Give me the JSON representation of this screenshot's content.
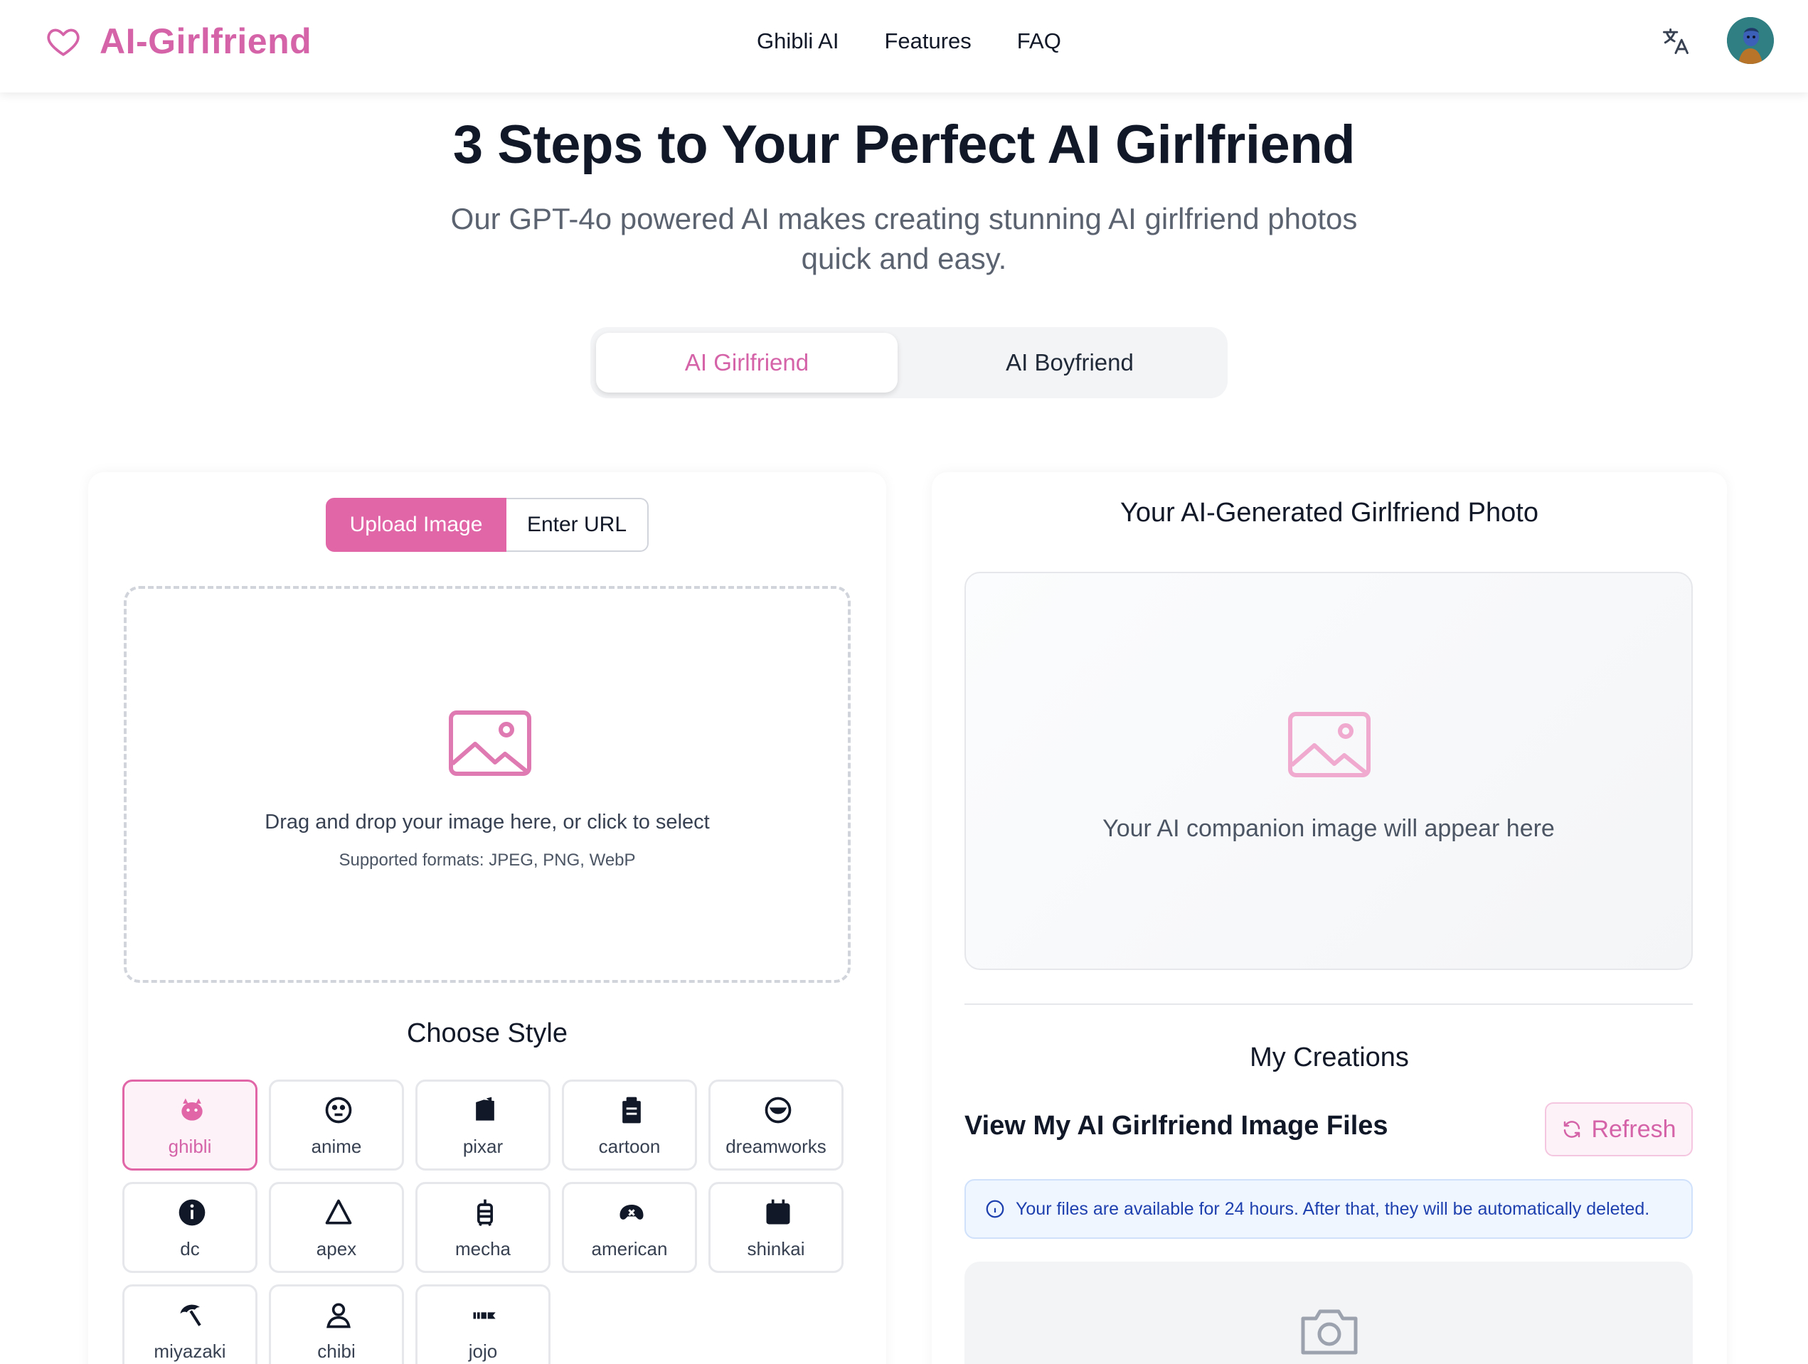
{
  "brand": {
    "name": "AI-Girlfriend",
    "color": "#d463a8"
  },
  "nav": {
    "items": [
      "Ghibli AI",
      "Features",
      "FAQ"
    ]
  },
  "header": {
    "language_icon": "translate-icon",
    "avatar_icon": "user-avatar"
  },
  "hero": {
    "title": "3 Steps to Your Perfect AI Girlfriend",
    "subtitle": "Our GPT-4o powered AI makes creating stunning AI girlfriend photos quick and easy."
  },
  "mode_toggle": {
    "options": [
      "AI Girlfriend",
      "AI Boyfriend"
    ],
    "selected": "AI Girlfriend"
  },
  "upload": {
    "tabs": [
      "Upload Image",
      "Enter URL"
    ],
    "selected_tab": "Upload Image",
    "drop_title": "Drag and drop your image here, or click to select",
    "drop_sub": "Supported formats: JPEG, PNG, WebP"
  },
  "styles": {
    "heading": "Choose Style",
    "selected": "ghibli",
    "items": [
      {
        "label": "ghibli",
        "icon": "ghibli-icon"
      },
      {
        "label": "anime",
        "icon": "anime-icon"
      },
      {
        "label": "pixar",
        "icon": "pixar-icon"
      },
      {
        "label": "cartoon",
        "icon": "cartoon-icon"
      },
      {
        "label": "dreamworks",
        "icon": "dreamworks-icon"
      },
      {
        "label": "dc",
        "icon": "dc-icon"
      },
      {
        "label": "apex",
        "icon": "apex-icon"
      },
      {
        "label": "mecha",
        "icon": "mecha-icon"
      },
      {
        "label": "american",
        "icon": "american-icon"
      },
      {
        "label": "shinkai",
        "icon": "shinkai-icon"
      },
      {
        "label": "miyazaki",
        "icon": "miyazaki-icon"
      },
      {
        "label": "chibi",
        "icon": "chibi-icon"
      },
      {
        "label": "jojo",
        "icon": "jojo-icon"
      }
    ]
  },
  "result": {
    "title": "Your AI-Generated Girlfriend Photo",
    "placeholder": "Your AI companion image will appear here"
  },
  "creations": {
    "title": "My Creations",
    "subtitle": "View My AI Girlfriend Image Files",
    "refresh_label": "Refresh",
    "info": "Your files are available for 24 hours. After that, they will be automatically deleted."
  },
  "colors": {
    "accent": "#e066a8",
    "accent_text": "#d463a8",
    "info_text": "#1e40af"
  }
}
